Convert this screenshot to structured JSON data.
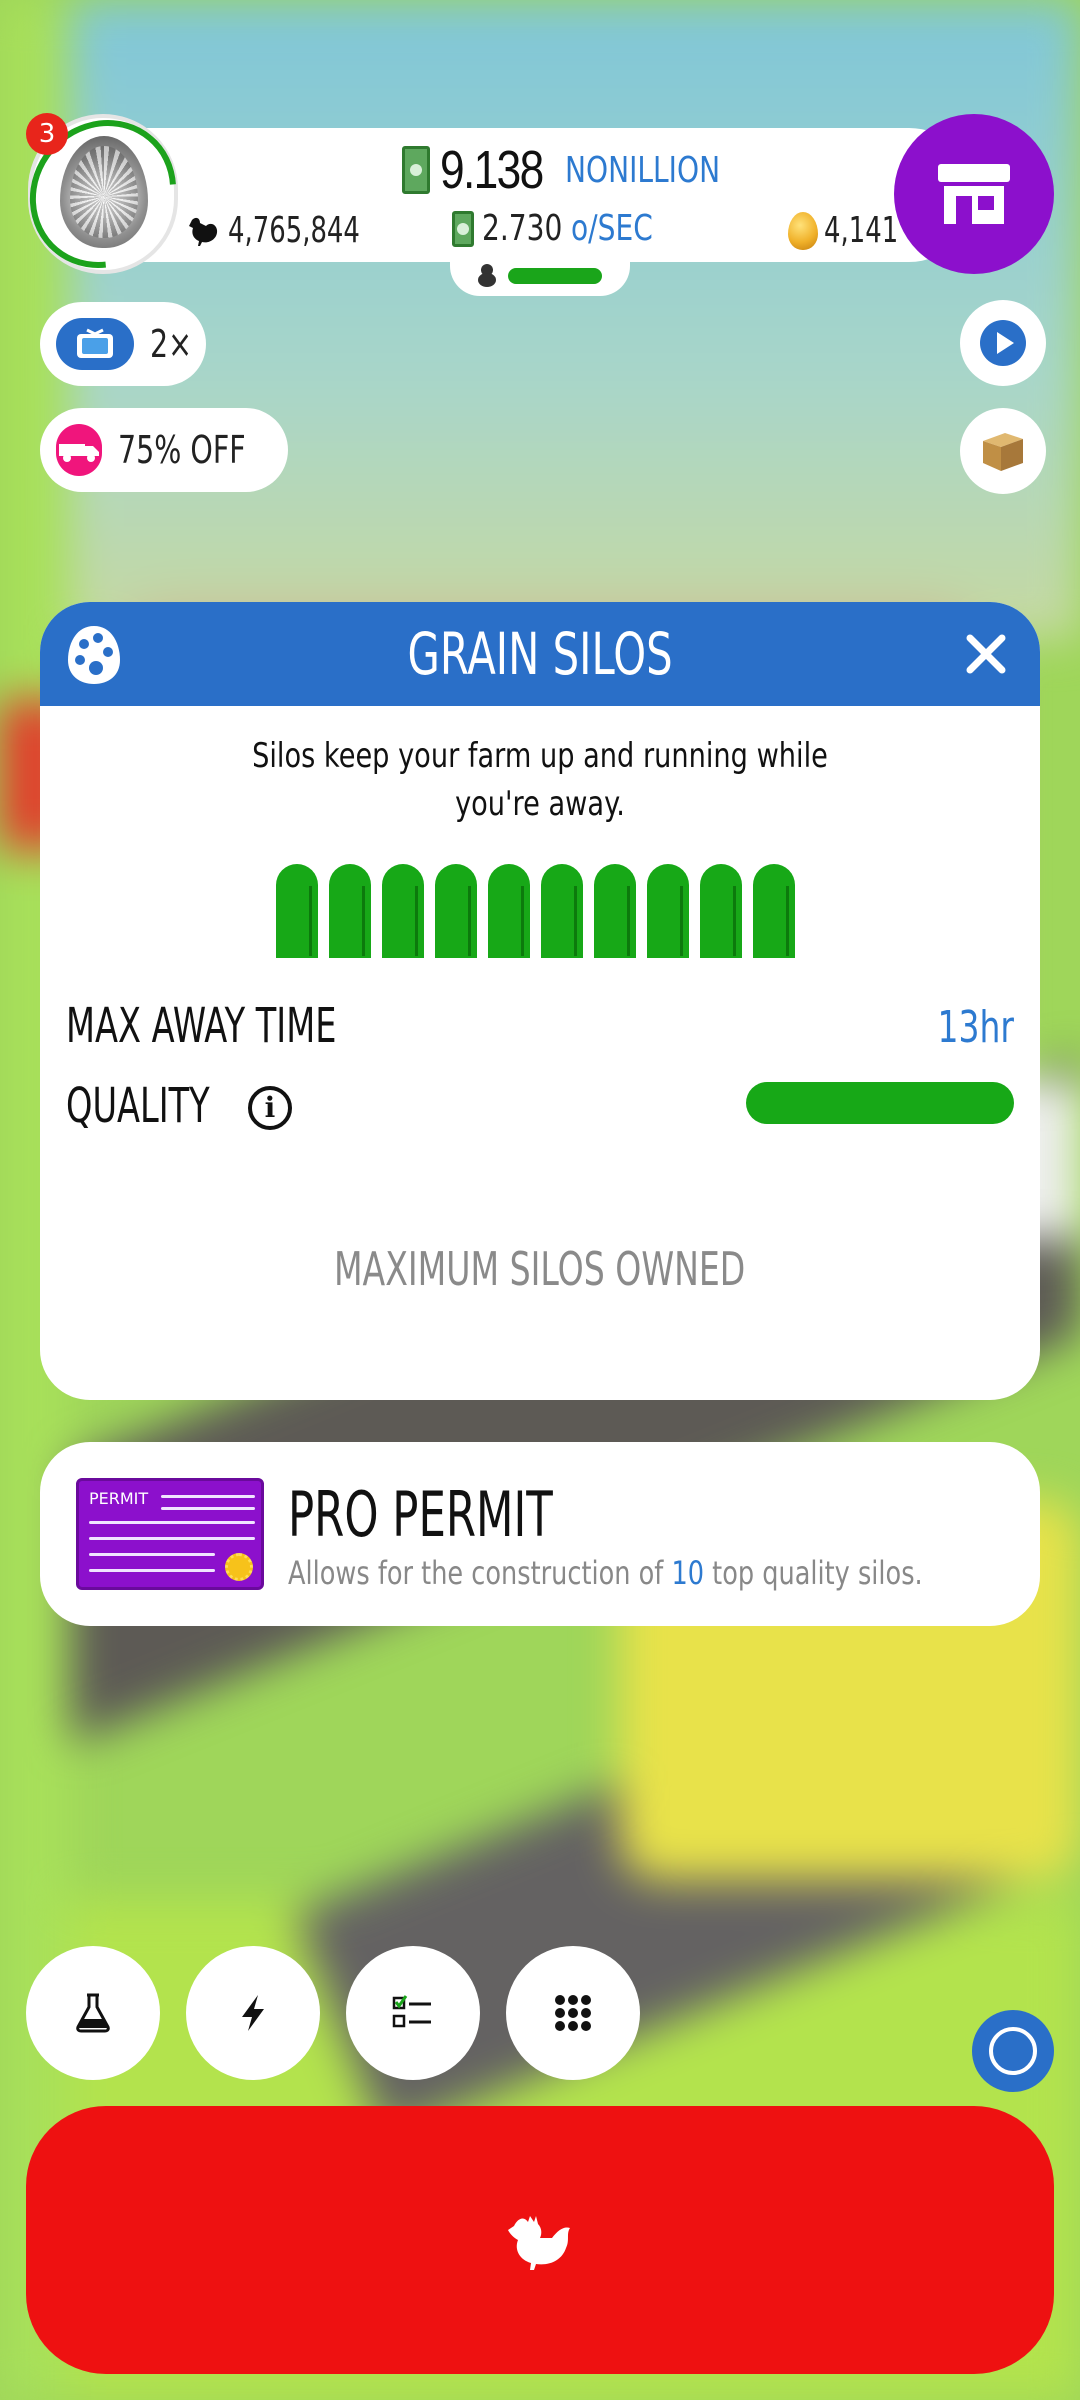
{
  "header": {
    "notification_count": "3",
    "money_value": "9.138",
    "money_unit": "NONILLION",
    "rate_value": "2.730",
    "rate_unit": "o/SEC",
    "chicken_count": "4,765,844",
    "golden_eggs": "4,141"
  },
  "boosts": {
    "video_multiplier": "2×",
    "vehicle_sale": "75% OFF"
  },
  "silo_panel": {
    "title": "GRAIN SILOS",
    "description": "Silos keep your farm up and running while you're away.",
    "silo_count": 10,
    "max_away_label": "MAX AWAY TIME",
    "max_away_value": "13hr",
    "quality_label": "QUALITY",
    "quality_level": 1.0,
    "status": "MAXIMUM SILOS OWNED"
  },
  "permit": {
    "image_text": "PERMIT",
    "title": "PRO PERMIT",
    "desc_prefix": "Allows for the construction of",
    "desc_number": "10",
    "desc_suffix": "top quality silos."
  },
  "icons": {
    "shop": "shop-icon",
    "research": "flask-icon",
    "boost": "lightning-icon",
    "missions": "checklist-icon",
    "menu": "grid-icon",
    "hatch": "chicken-icon",
    "palette": "palette-icon",
    "close": "close-icon"
  },
  "colors": {
    "header_blue": "#2a6fc8",
    "silo_green": "#17a817",
    "shop_purple": "#8c10cc",
    "hatch_red": "#ee1111",
    "accent_blue": "#2d7ad0"
  }
}
